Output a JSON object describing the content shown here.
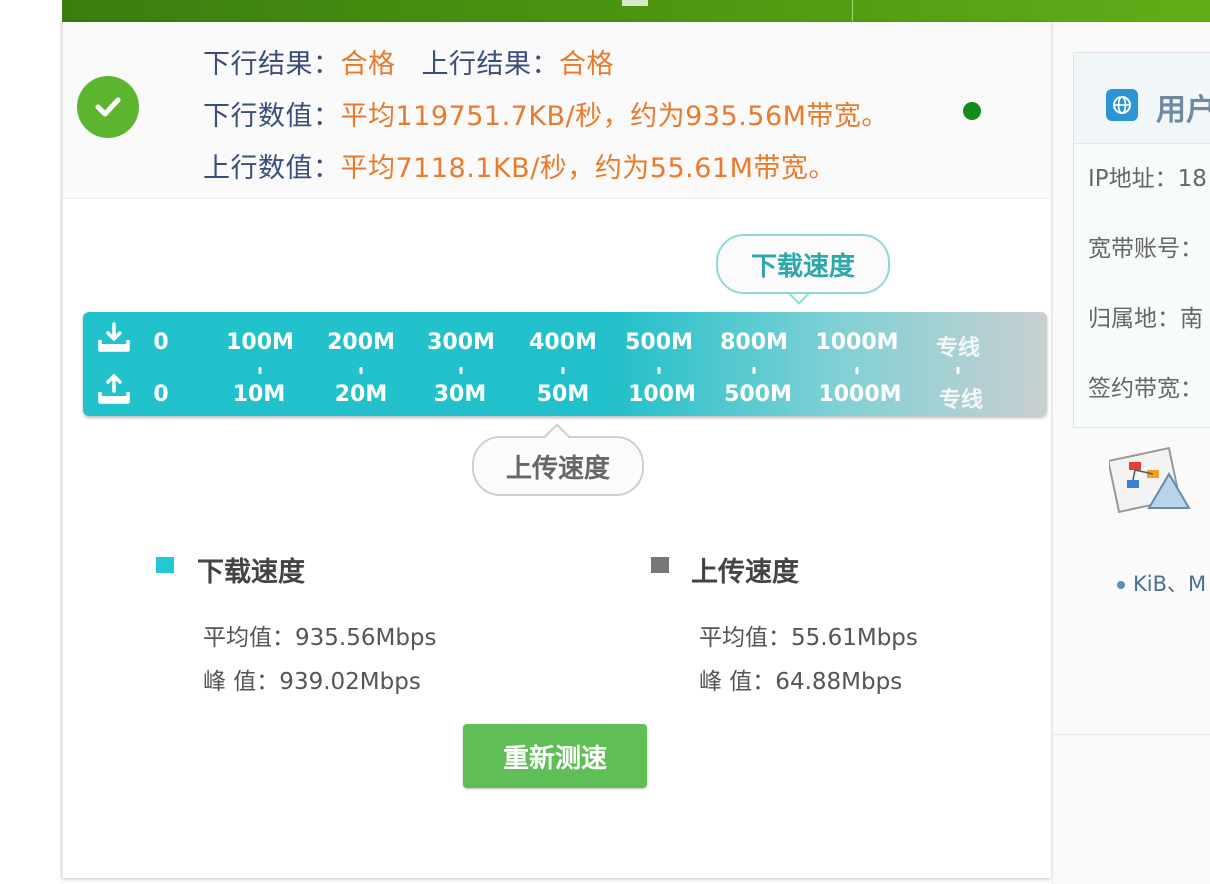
{
  "result": {
    "down_result_label": "下行结果：",
    "down_result_value": "合格",
    "up_result_label": "上行结果：",
    "up_result_value": "合格",
    "down_value_label": "下行数值：",
    "down_value_text": "平均119751.7KB/秒，约为935.56M带宽。",
    "up_value_label": "上行数值：",
    "up_value_text": "平均7118.1KB/秒，约为55.61M带宽。"
  },
  "scale": {
    "download_bubble": "下载速度",
    "upload_bubble": "上传速度",
    "download_ticks": [
      "0",
      "100M",
      "200M",
      "300M",
      "400M",
      "500M",
      "800M",
      "1000M",
      "专线"
    ],
    "upload_ticks": [
      "0",
      "10M",
      "20M",
      "30M",
      "50M",
      "100M",
      "500M",
      "1000M",
      "专线"
    ]
  },
  "legend": {
    "download_title": "下载速度",
    "download_avg": "平均值：935.56Mbps",
    "download_peak": "峰 值：939.02Mbps",
    "upload_title": "上传速度",
    "upload_avg": "平均值：55.61Mbps",
    "upload_peak": "峰 值：64.88Mbps"
  },
  "retest_label": "重新测速",
  "side": {
    "title": "用户",
    "ip_label": "IP地址：18",
    "account_label": "宽带账号：",
    "location_label": "归属地：南",
    "bandwidth_label": "签约带宽：",
    "unit_note": "KiB、M"
  },
  "colors": {
    "header_green": "#4f9a12",
    "success_green": "#5bb52e",
    "label_blue": "#3b4d7a",
    "value_orange": "#ea7a2a",
    "scale_cyan": "#21c2cc",
    "download_legend": "#22c8d6",
    "upload_legend": "#777777",
    "button_green": "#5fbf56",
    "status_dot": "#128a1c"
  }
}
